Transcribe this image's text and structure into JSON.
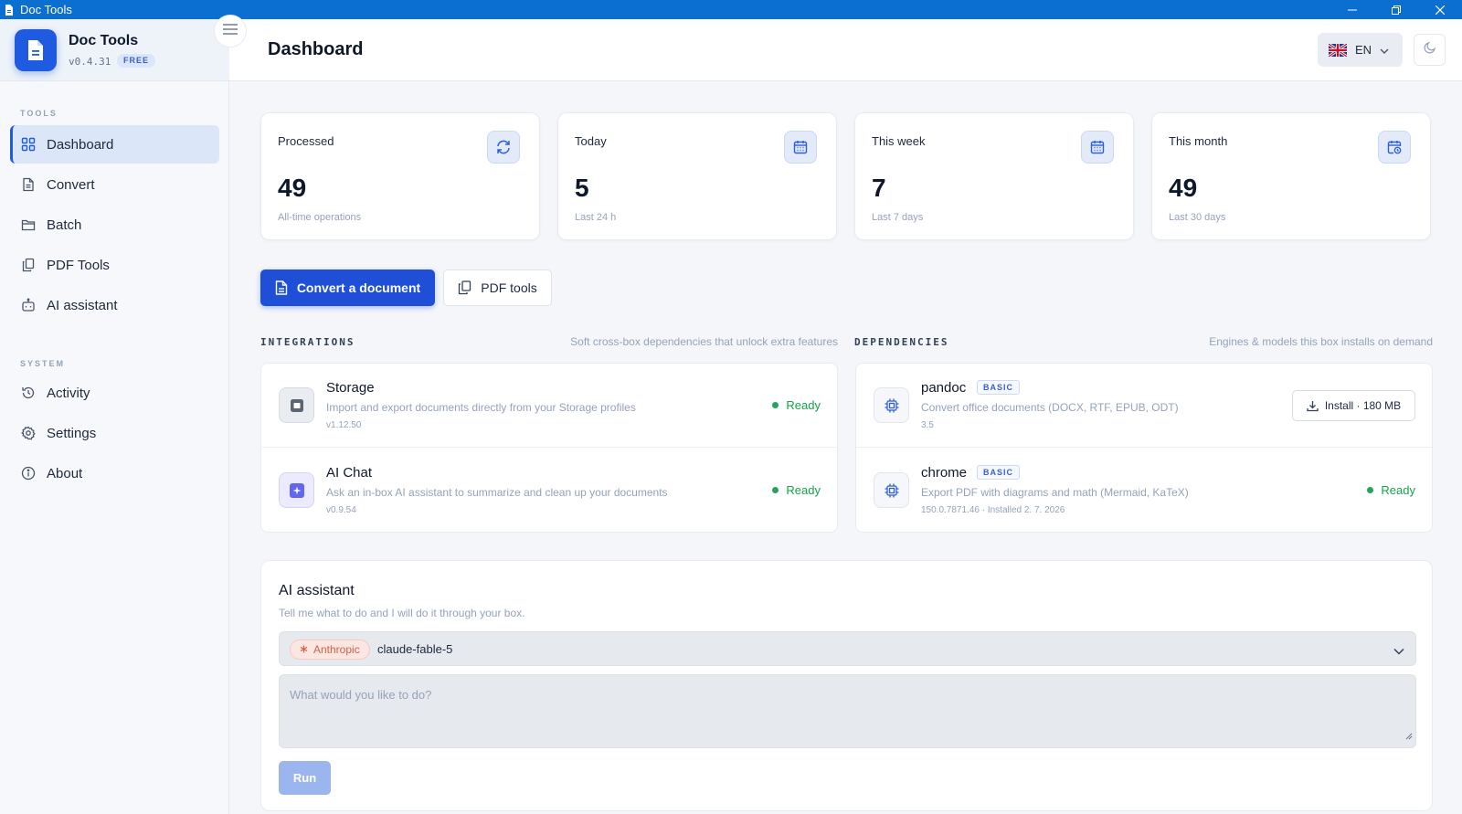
{
  "window": {
    "title": "Doc Tools"
  },
  "brand": {
    "name": "Doc Tools",
    "version": "v0.4.31",
    "badge": "FREE"
  },
  "sidebar": {
    "tools_label": "TOOLS",
    "tools": [
      {
        "label": "Dashboard",
        "icon": "grid-icon",
        "active": true
      },
      {
        "label": "Convert",
        "icon": "document-icon"
      },
      {
        "label": "Batch",
        "icon": "folder-icon"
      },
      {
        "label": "PDF Tools",
        "icon": "copy-icon"
      },
      {
        "label": "AI assistant",
        "icon": "bot-icon"
      }
    ],
    "system_label": "SYSTEM",
    "system": [
      {
        "label": "Activity",
        "icon": "history-icon"
      },
      {
        "label": "Settings",
        "icon": "gear-icon"
      },
      {
        "label": "About",
        "icon": "info-icon"
      }
    ]
  },
  "header": {
    "title": "Dashboard",
    "language": "EN",
    "theme_icon": "moon-icon"
  },
  "stats": [
    {
      "label": "Processed",
      "value": "49",
      "sub": "All-time operations",
      "icon": "refresh-icon"
    },
    {
      "label": "Today",
      "value": "5",
      "sub": "Last 24 h",
      "icon": "calendar-icon"
    },
    {
      "label": "This week",
      "value": "7",
      "sub": "Last 7 days",
      "icon": "calendar-icon"
    },
    {
      "label": "This month",
      "value": "49",
      "sub": "Last 30 days",
      "icon": "calendar-clock-icon"
    }
  ],
  "actions": {
    "primary": "Convert a document",
    "secondary": "PDF tools"
  },
  "integrations": {
    "title": "INTEGRATIONS",
    "description": "Soft cross-box dependencies that unlock extra features",
    "items": [
      {
        "name": "Storage",
        "description": "Import and export documents directly from your Storage profiles",
        "version": "v1.12.50",
        "status": "Ready"
      },
      {
        "name": "AI Chat",
        "description": "Ask an in-box AI assistant to summarize and clean up your documents",
        "version": "v0.9.54",
        "status": "Ready"
      }
    ]
  },
  "dependencies": {
    "title": "DEPENDENCIES",
    "description": "Engines & models this box installs on demand",
    "items": [
      {
        "name": "pandoc",
        "badge": "BASIC",
        "description": "Convert office documents (DOCX, RTF, EPUB, ODT)",
        "version": "3.5",
        "action": "Install · 180 MB"
      },
      {
        "name": "chrome",
        "badge": "BASIC",
        "description": "Export PDF with diagrams and math (Mermaid, KaTeX)",
        "version": "150.0.7871.46 · Installed 2. 7. 2026",
        "status": "Ready"
      }
    ]
  },
  "ai": {
    "title": "AI assistant",
    "subtitle": "Tell me what to do and I will do it through your box.",
    "provider": "Anthropic",
    "model": "claude-fable-5",
    "placeholder": "What would you like to do?",
    "run_label": "Run"
  },
  "colors": {
    "accent": "#1f4fd6",
    "titlebar": "#0a6fd1",
    "ready": "#16a34a",
    "provider": "#d26147"
  }
}
